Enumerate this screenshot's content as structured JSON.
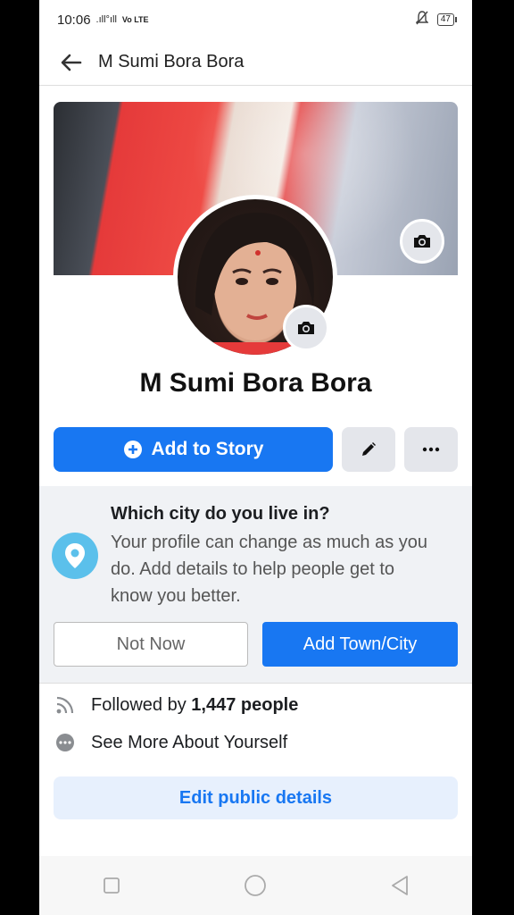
{
  "status_bar": {
    "time": "10:06",
    "signal": ".ıll°ıll",
    "network": "Vo LTE",
    "battery": "47"
  },
  "header": {
    "title": "M Sumi Bora Bora"
  },
  "profile": {
    "name": "M Sumi Bora Bora"
  },
  "actions": {
    "add_story_label": "Add to Story"
  },
  "city_prompt": {
    "title": "Which city do you live in?",
    "body": "Your profile can change as much as you do. Add details to help people get to know you better.",
    "not_now_label": "Not Now",
    "add_city_label": "Add Town/City"
  },
  "details": {
    "followed_prefix": "Followed by",
    "followed_count": "1,447 people",
    "see_more_label": "See More About Yourself",
    "edit_public_label": "Edit public details"
  },
  "colors": {
    "accent": "#1877f2",
    "prompt_bg": "#f0f2f5",
    "pin": "#5bc0eb"
  }
}
